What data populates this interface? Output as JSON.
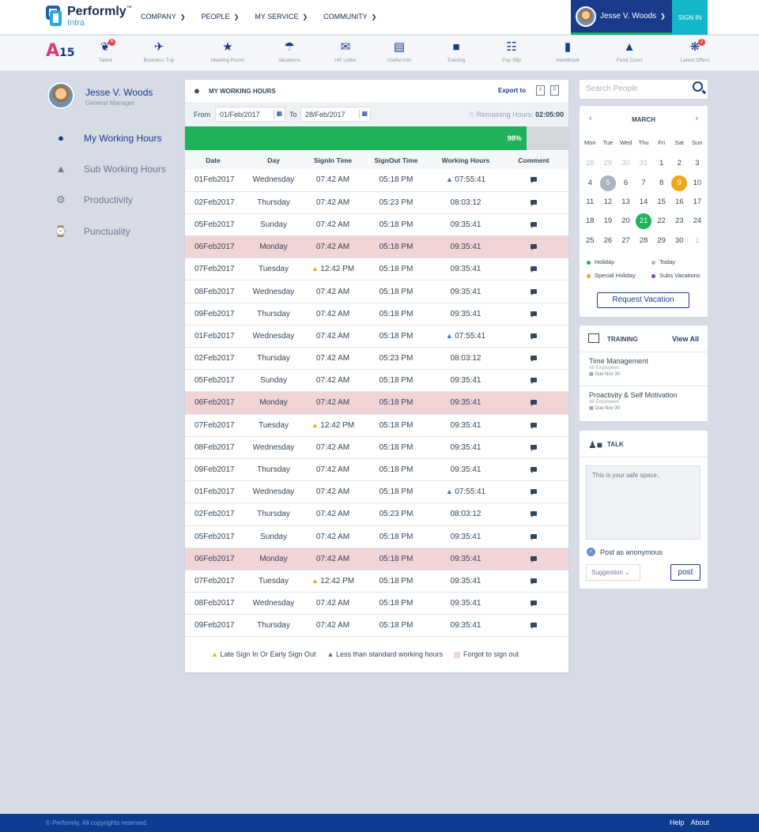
{
  "brand": {
    "name": "Performly",
    "tm": "™",
    "sub": "Intra"
  },
  "nav": [
    {
      "label": "COMPANY"
    },
    {
      "label": "PEOPLE"
    },
    {
      "label": "MY SERVICE"
    },
    {
      "label": "COMMUNITY"
    }
  ],
  "user": {
    "name": "Jesse V. Woods",
    "role": "General Manager",
    "signin": "SIGN IN"
  },
  "a15": {
    "a": "A",
    "n": "15"
  },
  "iconbar": [
    {
      "label": "Talent",
      "icon": "talent-icon",
      "badge": "6"
    },
    {
      "label": "Business Trip",
      "icon": "airplane-icon"
    },
    {
      "label": "Meeting Room",
      "icon": "meeting-icon"
    },
    {
      "label": "Vacations",
      "icon": "umbrella-icon"
    },
    {
      "label": "HR Letter",
      "icon": "mail-icon"
    },
    {
      "label": "Useful Info",
      "icon": "info-icon"
    },
    {
      "label": "Training",
      "icon": "training-icon"
    },
    {
      "label": "Pay Slip",
      "icon": "payslip-icon"
    },
    {
      "label": "Handbook",
      "icon": "book-icon"
    },
    {
      "label": "Food Court",
      "icon": "food-icon"
    },
    {
      "label": "Latest Offers",
      "icon": "offer-icon",
      "badge": "2"
    }
  ],
  "sidebar": [
    {
      "label": "My Working Hours",
      "icon": "clock-user-icon"
    },
    {
      "label": "Sub Working Hours",
      "icon": "hierarchy-icon"
    },
    {
      "label": "Productivity",
      "icon": "gear-icon"
    },
    {
      "label": "Punctuality",
      "icon": "watch-icon"
    }
  ],
  "working": {
    "title": "MY WORKING HOURS",
    "export": "Export to",
    "from_label": "From",
    "from": "01/Feb/2017",
    "to_label": "To",
    "to": "28/Feb/2017",
    "remaining_label": "Remaining Hours:",
    "remaining": "02:05:00",
    "progress_label": "98%",
    "progress": 0.89,
    "columns": [
      "Date",
      "Day",
      "SignIn Time",
      "SignOut Time",
      "Working Hours",
      "Comment"
    ],
    "rows": [
      {
        "date": "01Feb2017",
        "day": "Wednesday",
        "in": "07:42 AM",
        "out": "05:18 PM",
        "hours": "07:55:41",
        "flag": "under"
      },
      {
        "date": "02Feb2017",
        "day": "Thursday",
        "in": "07:42 AM",
        "out": "05:23 PM",
        "hours": "08:03:12"
      },
      {
        "date": "05Feb2017",
        "day": "Sunday",
        "in": "07:42 AM",
        "out": "05:18 PM",
        "hours": "09:35:41"
      },
      {
        "date": "06Feb2017",
        "day": "Monday",
        "in": "07:42 AM",
        "out": "05:18 PM",
        "hours": "09:35:41",
        "pink": true
      },
      {
        "date": "07Feb2017",
        "day": "Tuesday",
        "in": "12:42 PM",
        "out": "05:18 PM",
        "hours": "09:35:41",
        "late": true
      },
      {
        "date": "08Feb2017",
        "day": "Wednesday",
        "in": "07:42 AM",
        "out": "05:18 PM",
        "hours": "09:35:41"
      },
      {
        "date": "09Feb2017",
        "day": "Thursday",
        "in": "07:42 AM",
        "out": "05:18 PM",
        "hours": "09:35:41"
      },
      {
        "date": "01Feb2017",
        "day": "Wednesday",
        "in": "07:42 AM",
        "out": "05:18 PM",
        "hours": "07:55:41",
        "flag": "under"
      },
      {
        "date": "02Feb2017",
        "day": "Thursday",
        "in": "07:42 AM",
        "out": "05:23 PM",
        "hours": "08:03:12"
      },
      {
        "date": "05Feb2017",
        "day": "Sunday",
        "in": "07:42 AM",
        "out": "05:18 PM",
        "hours": "09:35:41"
      },
      {
        "date": "06Feb2017",
        "day": "Monday",
        "in": "07:42 AM",
        "out": "05:18 PM",
        "hours": "09:35:41",
        "pink": true
      },
      {
        "date": "07Feb2017",
        "day": "Tuesday",
        "in": "12:42 PM",
        "out": "05:18 PM",
        "hours": "09:35:41",
        "late": true
      },
      {
        "date": "08Feb2017",
        "day": "Wednesday",
        "in": "07:42 AM",
        "out": "05:18 PM",
        "hours": "09:35:41"
      },
      {
        "date": "09Feb2017",
        "day": "Thursday",
        "in": "07:42 AM",
        "out": "05:18 PM",
        "hours": "09:35:41"
      },
      {
        "date": "01Feb2017",
        "day": "Wednesday",
        "in": "07:42 AM",
        "out": "05:18 PM",
        "hours": "07:55:41",
        "flag": "under"
      },
      {
        "date": "02Feb2017",
        "day": "Thursday",
        "in": "07:42 AM",
        "out": "05:23 PM",
        "hours": "08:03:12"
      },
      {
        "date": "05Feb2017",
        "day": "Sunday",
        "in": "07:42 AM",
        "out": "05:18 PM",
        "hours": "09:35:41"
      },
      {
        "date": "06Feb2017",
        "day": "Monday",
        "in": "07:42 AM",
        "out": "05:18 PM",
        "hours": "09:35:41",
        "pink": true
      },
      {
        "date": "07Feb2017",
        "day": "Tuesday",
        "in": "12:42 PM",
        "out": "05:18 PM",
        "hours": "09:35:41",
        "late": true
      },
      {
        "date": "08Feb2017",
        "day": "Wednesday",
        "in": "07:42 AM",
        "out": "05:18 PM",
        "hours": "09:35:41"
      },
      {
        "date": "09Feb2017",
        "day": "Thursday",
        "in": "07:42 AM",
        "out": "05:18 PM",
        "hours": "09:35:41"
      }
    ],
    "legend": {
      "late": "Late Sign In Or Early Sign Out",
      "under": "Less than standard working hours",
      "forgot": "Forgot to sign out"
    }
  },
  "search": {
    "placeholder": "Search People"
  },
  "calendar": {
    "month": "MARCH",
    "weekdays": [
      "Mon",
      "Tue",
      "Wed",
      "Thu",
      "Fri",
      "Sat",
      "Sun"
    ],
    "days": [
      {
        "d": "28",
        "m": true
      },
      {
        "d": "29",
        "m": true
      },
      {
        "d": "30",
        "m": true
      },
      {
        "d": "31",
        "m": true
      },
      {
        "d": "1"
      },
      {
        "d": "2"
      },
      {
        "d": "3"
      },
      {
        "d": "4"
      },
      {
        "d": "5",
        "s": "today"
      },
      {
        "d": "6"
      },
      {
        "d": "7"
      },
      {
        "d": "8"
      },
      {
        "d": "9",
        "s": "hol"
      },
      {
        "d": "10"
      },
      {
        "d": "11"
      },
      {
        "d": "12"
      },
      {
        "d": "13"
      },
      {
        "d": "14"
      },
      {
        "d": "15"
      },
      {
        "d": "16"
      },
      {
        "d": "17"
      },
      {
        "d": "18"
      },
      {
        "d": "19"
      },
      {
        "d": "20"
      },
      {
        "d": "21",
        "s": "gr"
      },
      {
        "d": "22"
      },
      {
        "d": "23"
      },
      {
        "d": "24"
      },
      {
        "d": "25"
      },
      {
        "d": "26"
      },
      {
        "d": "27"
      },
      {
        "d": "28"
      },
      {
        "d": "29"
      },
      {
        "d": "30"
      },
      {
        "d": "1",
        "m": true
      }
    ],
    "legend": [
      {
        "label": "Holiday",
        "color": "#1fb25a"
      },
      {
        "label": "Today",
        "color": "#aab3c2"
      },
      {
        "label": "Special Holiday",
        "color": "#f0a81a"
      },
      {
        "label": "Subs Vacations",
        "color": "#7b3fd4"
      }
    ],
    "request": "Request Vacation"
  },
  "training": {
    "title": "TRAINING",
    "view_all": "View All",
    "items": [
      {
        "name": "Time Management",
        "sub": "All Employees",
        "due": "Due Nov 30"
      },
      {
        "name": "Proactivity & Self Motivation",
        "sub": "All Employees",
        "due": "Due Nov 30"
      }
    ]
  },
  "talk": {
    "title": "TALK",
    "placeholder": "This is your safe space..",
    "anon": "Post as anonymous",
    "select": "Suggestion",
    "post": "post"
  },
  "footer": {
    "copyright": "© Performly, All copyrights reserved.",
    "help": "Help",
    "about": "About"
  }
}
